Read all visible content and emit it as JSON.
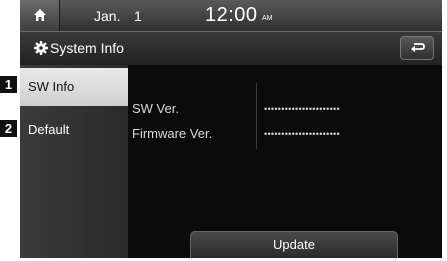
{
  "status_bar": {
    "home_icon": "home-icon",
    "month": "Jan.",
    "day": "1",
    "time": "12:00",
    "ampm": "AM"
  },
  "title_bar": {
    "icon": "gear-icon",
    "title": "System Info",
    "back_icon": "back-arrow-icon"
  },
  "sidebar": {
    "items": [
      {
        "label": "SW Info",
        "selected": true
      },
      {
        "label": "Default",
        "selected": false
      }
    ]
  },
  "main": {
    "sw_ver_label": "SW Ver.",
    "sw_ver_value": "••••••••••••••••••••••",
    "fw_ver_label": "Firmware Ver.",
    "fw_ver_value": "••••••••••••••••••••••",
    "update_label": "Update"
  },
  "callouts": [
    "1",
    "2"
  ],
  "colors": {
    "screen_bg": "#0a0a0a",
    "selected_item_bg": "#dcdcdc",
    "text": "#ffffff"
  }
}
